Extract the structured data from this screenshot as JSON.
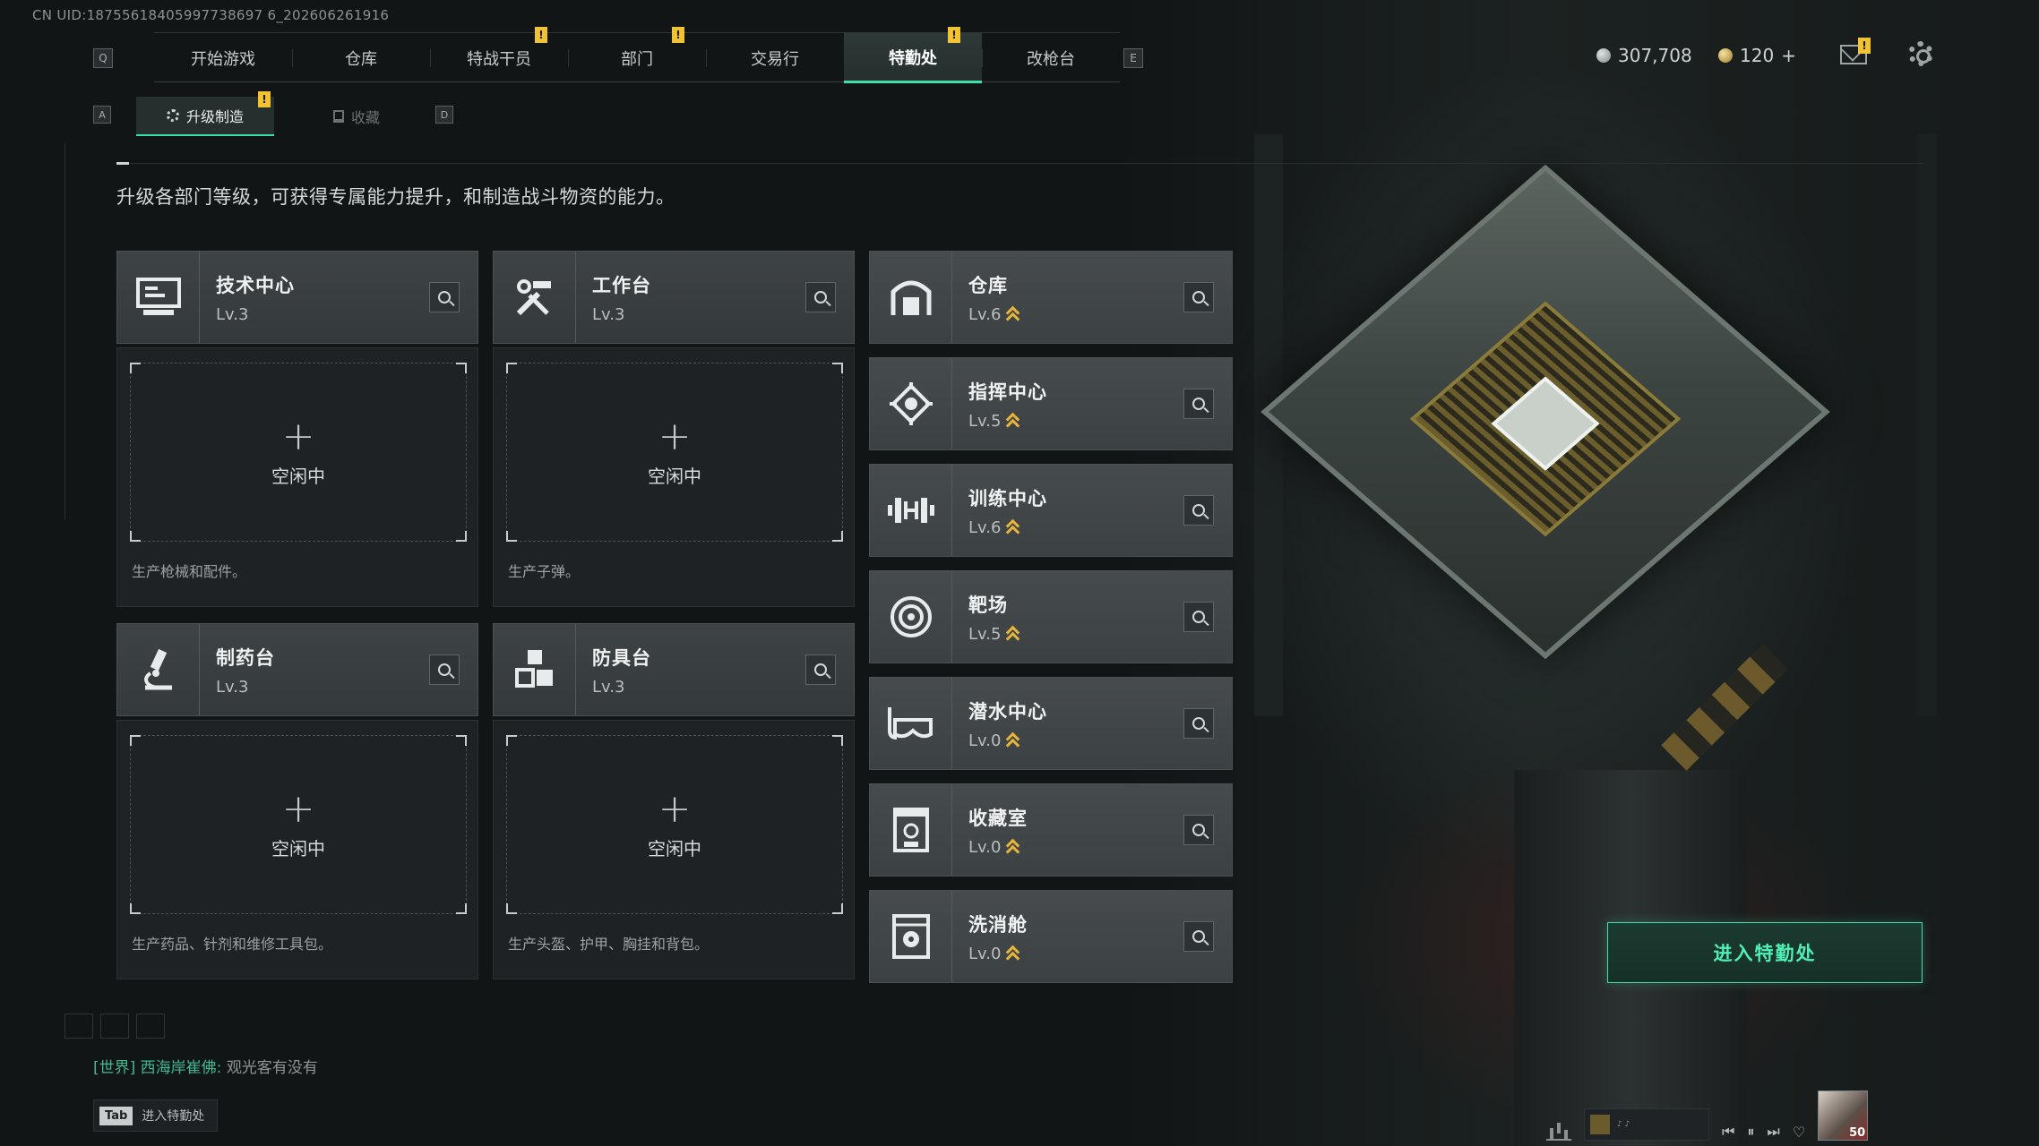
{
  "uid": "CN UID:18755618405997738697 6_202606261916",
  "keys": {
    "left_bracket": "Q",
    "right_bracket": "E",
    "sub_left": "A",
    "sub_right": "D"
  },
  "tabs": [
    "开始游戏",
    "仓库",
    "特战干员",
    "部门",
    "交易行",
    "特勤处",
    "改枪台"
  ],
  "active_tab": "特勤处",
  "currency": {
    "silver": "307,708",
    "gold": "120"
  },
  "subtabs": {
    "upgrade": "升级制造",
    "collection": "收藏"
  },
  "description": "升级各部门等级，可获得专属能力提升，和制造战斗物资的能力。",
  "production": [
    {
      "name": "技术中心",
      "level": "Lv.3",
      "icon": "computer-icon",
      "slot": "空闲中",
      "desc": "生产枪械和配件。"
    },
    {
      "name": "工作台",
      "level": "Lv.3",
      "icon": "tools-icon",
      "slot": "空闲中",
      "desc": "生产子弹。"
    },
    {
      "name": "制药台",
      "level": "Lv.3",
      "icon": "microscope-icon",
      "slot": "空闲中",
      "desc": "生产药品、针剂和维修工具包。"
    },
    {
      "name": "防具台",
      "level": "Lv.3",
      "icon": "armor-blocks-icon",
      "slot": "空闲中",
      "desc": "生产头盔、护甲、胸挂和背包。"
    }
  ],
  "departments": [
    {
      "name": "仓库",
      "level": "Lv.6",
      "icon": "warehouse-icon"
    },
    {
      "name": "指挥中心",
      "level": "Lv.5",
      "icon": "command-icon"
    },
    {
      "name": "训练中心",
      "level": "Lv.6",
      "icon": "dumbbell-icon"
    },
    {
      "name": "靶场",
      "level": "Lv.5",
      "icon": "target-icon"
    },
    {
      "name": "潜水中心",
      "level": "Lv.0",
      "icon": "diving-mask-icon"
    },
    {
      "name": "收藏室",
      "level": "Lv.0",
      "icon": "trophy-case-icon"
    },
    {
      "name": "洗消舱",
      "level": "Lv.0",
      "icon": "hazmat-icon"
    }
  ],
  "enter_button": "进入特勤处",
  "chat": {
    "channel": "[世界] 西海岸崔佛:",
    "message": "观光客有没有"
  },
  "tab_hint": {
    "key": "Tab",
    "label": "进入特勤处"
  },
  "avatar_level": "50",
  "colors": {
    "accent": "#3fe0a8",
    "warning": "#f1c232",
    "upgrade": "#e7b53a"
  }
}
